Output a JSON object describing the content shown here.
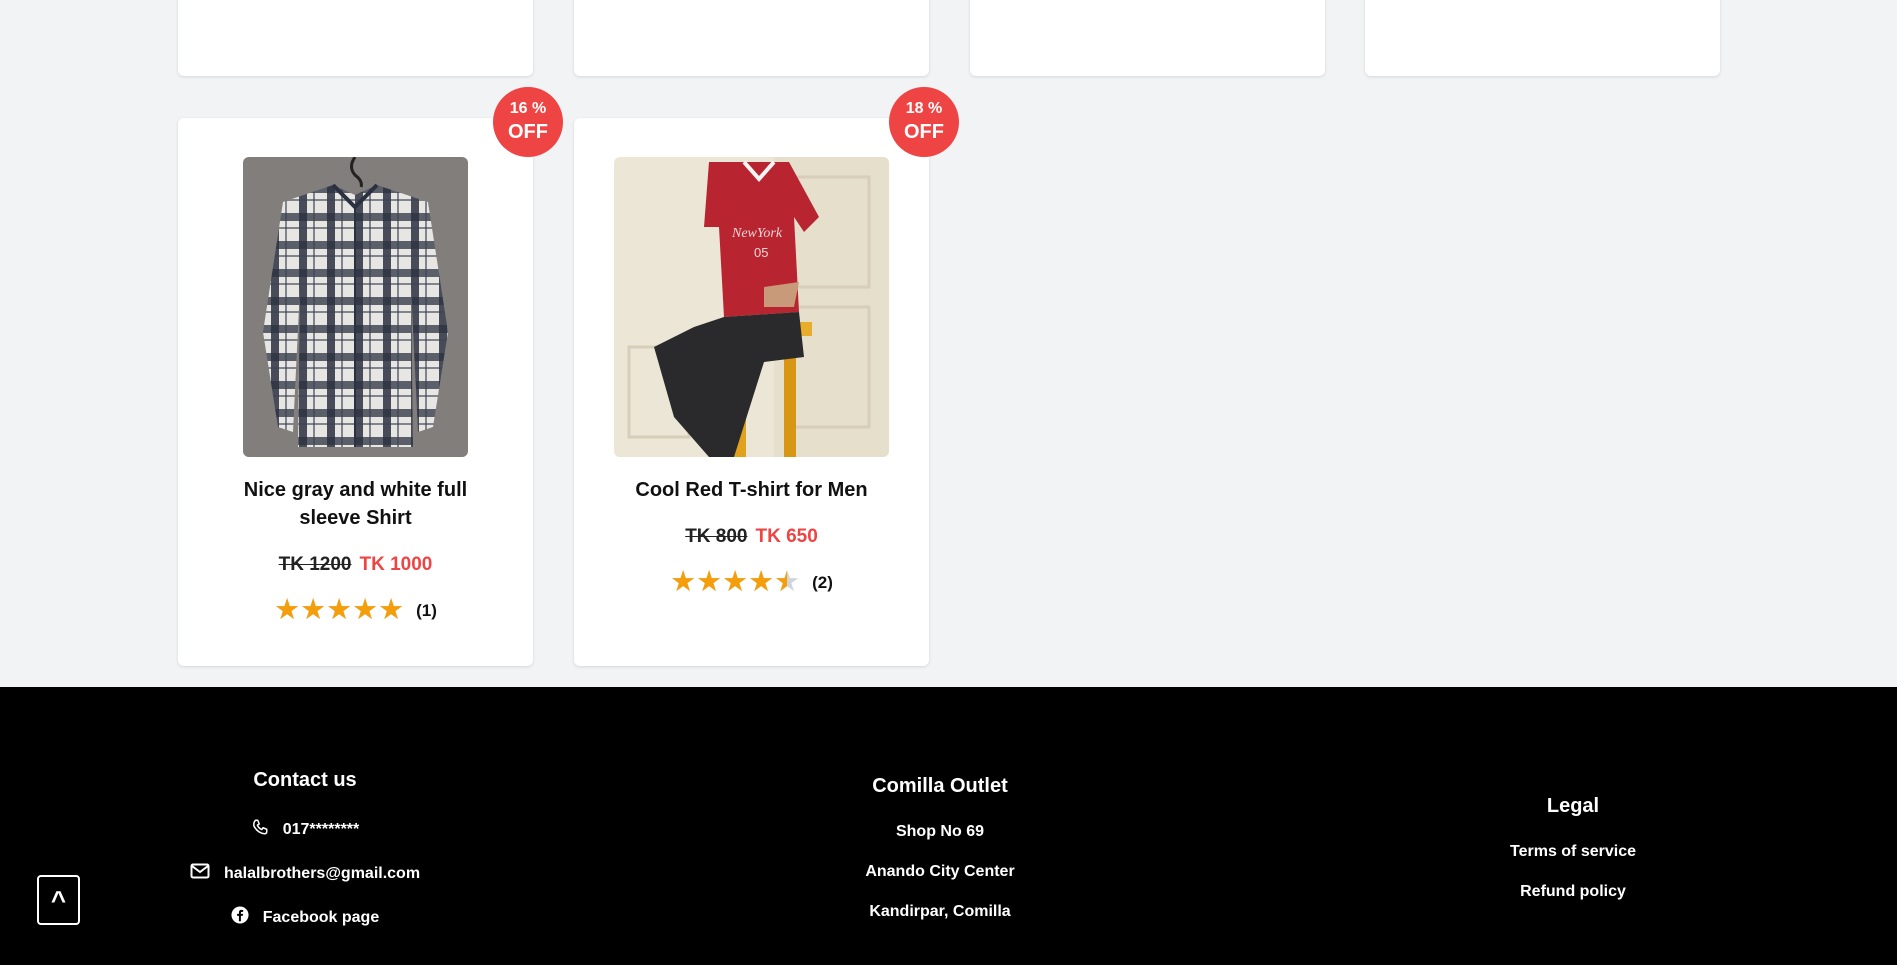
{
  "products": [
    {
      "discount_pct": "16 %",
      "discount_label": "OFF",
      "title": "Nice gray and white full sleeve Shirt",
      "old_price": "TK 1200",
      "new_price": "TK 1000",
      "rating": 5,
      "rating_count": "(1)",
      "image": "plaid-shirt-image"
    },
    {
      "discount_pct": "18 %",
      "discount_label": "OFF",
      "title": "Cool Red T-shirt for Men",
      "old_price": "TK 800",
      "new_price": "TK 650",
      "rating": 4.5,
      "rating_count": "(2)",
      "image": "red-tshirt-model-image"
    }
  ],
  "stars_glyph": "★★★★★",
  "footer": {
    "contact": {
      "heading": "Contact us",
      "phone": "017********",
      "email": "halalbrothers@gmail.com",
      "facebook": "Facebook page"
    },
    "outlet": {
      "heading": "Comilla Outlet",
      "line1": "Shop No 69",
      "line2": "Anando City Center",
      "line3": "Kandirpar, Comilla"
    },
    "legal": {
      "heading": "Legal",
      "terms": "Terms of service",
      "refund": "Refund policy"
    }
  },
  "scroll_top_label": "^",
  "colors": {
    "accent": "#ef4444",
    "star": "#f59e0b",
    "footer_bg": "#000000",
    "page_bg": "#f2f3f5"
  }
}
